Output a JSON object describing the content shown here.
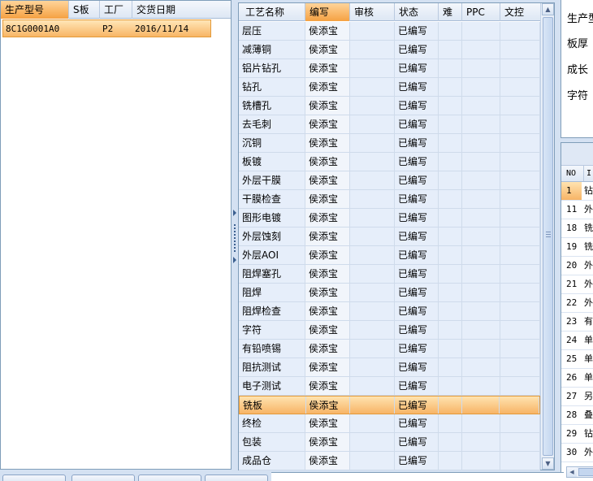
{
  "left_grid": {
    "columns": [
      "生产型号",
      "S板",
      "工厂",
      "交货日期"
    ],
    "rows": [
      [
        "8C1G0001A0",
        "",
        "P2",
        "2016/11/14"
      ]
    ]
  },
  "process_grid": {
    "columns": [
      "工艺名称",
      "编写",
      "审核",
      "状态",
      "难",
      "PPC",
      "文控"
    ],
    "rows": [
      [
        "层压",
        "侯添宝",
        "",
        "已编写",
        "",
        "",
        ""
      ],
      [
        "减薄铜",
        "侯添宝",
        "",
        "已编写",
        "",
        "",
        ""
      ],
      [
        "铝片钻孔",
        "侯添宝",
        "",
        "已编写",
        "",
        "",
        ""
      ],
      [
        "钻孔",
        "侯添宝",
        "",
        "已编写",
        "",
        "",
        ""
      ],
      [
        "铣槽孔",
        "侯添宝",
        "",
        "已编写",
        "",
        "",
        ""
      ],
      [
        "去毛刺",
        "侯添宝",
        "",
        "已编写",
        "",
        "",
        ""
      ],
      [
        "沉铜",
        "侯添宝",
        "",
        "已编写",
        "",
        "",
        ""
      ],
      [
        "板镀",
        "侯添宝",
        "",
        "已编写",
        "",
        "",
        ""
      ],
      [
        "外层干膜",
        "侯添宝",
        "",
        "已编写",
        "",
        "",
        ""
      ],
      [
        "干膜检查",
        "侯添宝",
        "",
        "已编写",
        "",
        "",
        ""
      ],
      [
        "图形电镀",
        "侯添宝",
        "",
        "已编写",
        "",
        "",
        ""
      ],
      [
        "外层蚀刻",
        "侯添宝",
        "",
        "已编写",
        "",
        "",
        ""
      ],
      [
        "外层AOI",
        "侯添宝",
        "",
        "已编写",
        "",
        "",
        ""
      ],
      [
        "阻焊塞孔",
        "侯添宝",
        "",
        "已编写",
        "",
        "",
        ""
      ],
      [
        "阻焊",
        "侯添宝",
        "",
        "已编写",
        "",
        "",
        ""
      ],
      [
        "阻焊检查",
        "侯添宝",
        "",
        "已编写",
        "",
        "",
        ""
      ],
      [
        "字符",
        "侯添宝",
        "",
        "已编写",
        "",
        "",
        ""
      ],
      [
        "有铅喷锡",
        "侯添宝",
        "",
        "已编写",
        "",
        "",
        ""
      ],
      [
        "阻抗测试",
        "侯添宝",
        "",
        "已编写",
        "",
        "",
        ""
      ],
      [
        "电子测试",
        "侯添宝",
        "",
        "已编写",
        "",
        "",
        ""
      ],
      [
        "铣板",
        "侯添宝",
        "",
        "已编写",
        "",
        "",
        ""
      ],
      [
        "终检",
        "侯添宝",
        "",
        "已编写",
        "",
        "",
        ""
      ],
      [
        "包装",
        "侯添宝",
        "",
        "已编写",
        "",
        "",
        ""
      ],
      [
        "成品仓",
        "侯添宝",
        "",
        "已编写",
        "",
        "",
        ""
      ]
    ],
    "selected_index": 20
  },
  "detail_labels": [
    "生产型",
    "板厚",
    "成长",
    "字符"
  ],
  "right_grid": {
    "header_no": "NO",
    "header_next": "I",
    "rows": [
      [
        "1",
        "钻"
      ],
      [
        "11",
        "外"
      ],
      [
        "18",
        "铣"
      ],
      [
        "19",
        "铣"
      ],
      [
        "20",
        "外"
      ],
      [
        "21",
        "外"
      ],
      [
        "22",
        "外"
      ],
      [
        "23",
        "有"
      ],
      [
        "24",
        "单"
      ],
      [
        "25",
        "单"
      ],
      [
        "26",
        "单"
      ],
      [
        "27",
        "另"
      ],
      [
        "28",
        "叠"
      ],
      [
        "29",
        "钻"
      ],
      [
        "30",
        "外"
      ]
    ]
  },
  "colors": {
    "accent_orange": "#f7b466",
    "header_blue": "#dde7f4",
    "row_blue": "#e6eefa"
  }
}
